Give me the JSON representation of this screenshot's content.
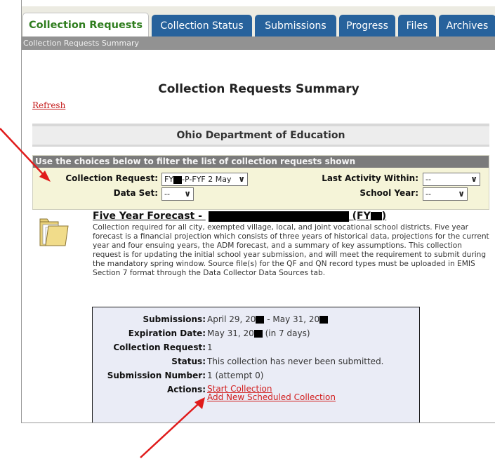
{
  "tabs": [
    {
      "label": "Collection Requests",
      "active": true
    },
    {
      "label": "Collection Status",
      "active": false
    },
    {
      "label": "Submissions",
      "active": false
    },
    {
      "label": "Progress",
      "active": false
    },
    {
      "label": "Files",
      "active": false
    },
    {
      "label": "Archives",
      "active": false
    }
  ],
  "breadcrumb": "Collection Requests Summary",
  "page": {
    "title": "Collection Requests Summary",
    "refresh_label": "Refresh",
    "department": "Ohio Department of Education"
  },
  "filter": {
    "header": "Use the choices below to filter the list of collection requests shown",
    "collection_request_label": "Collection Request:",
    "collection_request_value_prefix": "FY",
    "collection_request_value_suffix": "-P-FYF 2 May",
    "data_set_label": "Data Set:",
    "data_set_value": "--",
    "last_activity_label": "Last Activity Within:",
    "last_activity_value": "--",
    "school_year_label": "School Year:",
    "school_year_value": "--"
  },
  "forecast": {
    "title_prefix": "Five Year Forecast -",
    "title_suffix_open": "(FY",
    "title_suffix_close": ")",
    "description": "Collection required for all city, exempted village, local, and joint vocational school districts. Five year forecast is a financial projection which consists of three years of historical data, projections for the current year and four ensuing years, the ADM forecast, and a summary of key assumptions. This collection request is for updating the initial school year submission, and will meet the requirement to submit during the mandatory spring window. Source file(s) for the QF and QN record types must be uploaded in EMIS Section 7 format through the Data Collector Data Sources tab."
  },
  "details": {
    "submissions_label": "Submissions:",
    "submissions_start": "April 29, 20",
    "submissions_sep": " - May 31, 20",
    "expiration_label": "Expiration Date:",
    "expiration_value": "May 31, 20",
    "expiration_note": "(in 7 days)",
    "collection_request_label": "Collection Request:",
    "collection_request_value": "1",
    "status_label": "Status:",
    "status_value": "This collection has never been submitted.",
    "submission_number_label": "Submission Number:",
    "submission_number_value": "1 (attempt 0)",
    "actions_label": "Actions:",
    "start_collection": "Start Collection",
    "add_scheduled": "Add New Scheduled Collection"
  },
  "colors": {
    "tab_blue": "#27629c",
    "active_tab_text": "#2f7d1e",
    "link_red": "#c41a1a",
    "filter_bg": "#f5f4d8",
    "details_bg": "#eaecf6",
    "annotation_arrow": "#e01b1b"
  },
  "icons": [
    "folder-icon",
    "chevron-down-icon",
    "annotation-arrow"
  ]
}
